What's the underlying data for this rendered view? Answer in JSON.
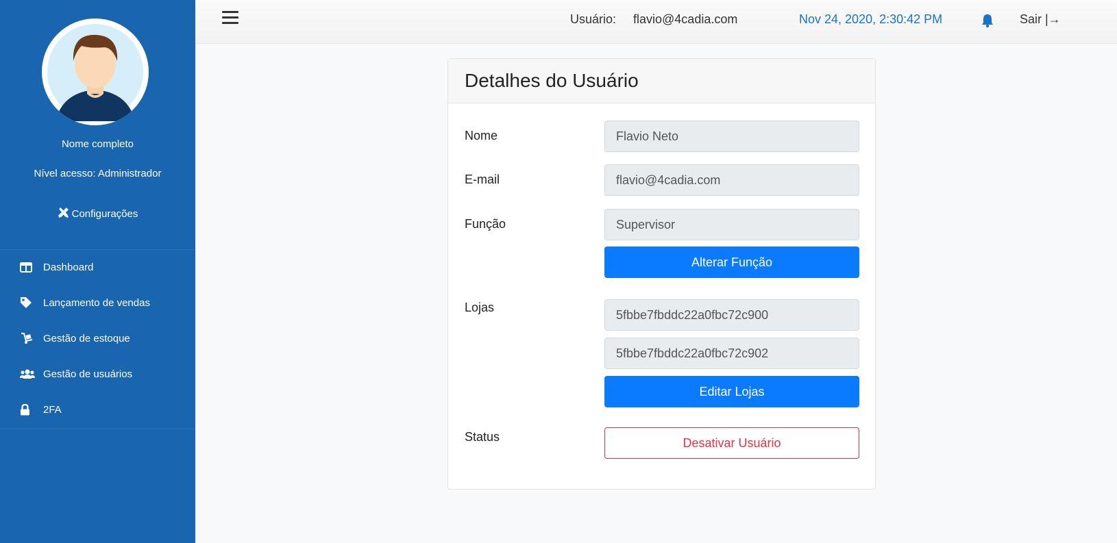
{
  "sidebar": {
    "profile_name": "Nome completo",
    "profile_level": "Nível acesso: Administrador",
    "config_label": "Configurações",
    "items": [
      {
        "label": "Dashboard",
        "icon": "dashboard-icon"
      },
      {
        "label": "Lançamento de vendas",
        "icon": "tag-icon"
      },
      {
        "label": "Gestão de estoque",
        "icon": "dolly-icon"
      },
      {
        "label": "Gestão de usuários",
        "icon": "users-icon"
      },
      {
        "label": "2FA",
        "icon": "lock-icon"
      }
    ]
  },
  "topbar": {
    "user_label": "Usuário:",
    "user_email": "flavio@4cadia.com",
    "datetime": "Nov 24, 2020, 2:30:42 PM",
    "logout_label": "Sair |→"
  },
  "card": {
    "title": "Detalhes do Usuário",
    "nome_label": "Nome",
    "nome_value": "Flavio Neto",
    "email_label": "E-mail",
    "email_value": "flavio@4cadia.com",
    "funcao_label": "Função",
    "funcao_value": "Supervisor",
    "alterar_funcao": "Alterar Função",
    "lojas_label": "Lojas",
    "lojas": [
      "5fbbe7fbddc22a0fbc72c900",
      "5fbbe7fbddc22a0fbc72c902"
    ],
    "editar_lojas": "Editar Lojas",
    "status_label": "Status",
    "desativar": "Desativar Usuário"
  },
  "colors": {
    "sidebar_bg": "#1a65b0",
    "primary": "#0a7bff",
    "danger": "#dc3545",
    "datetime": "#1a73c9"
  }
}
